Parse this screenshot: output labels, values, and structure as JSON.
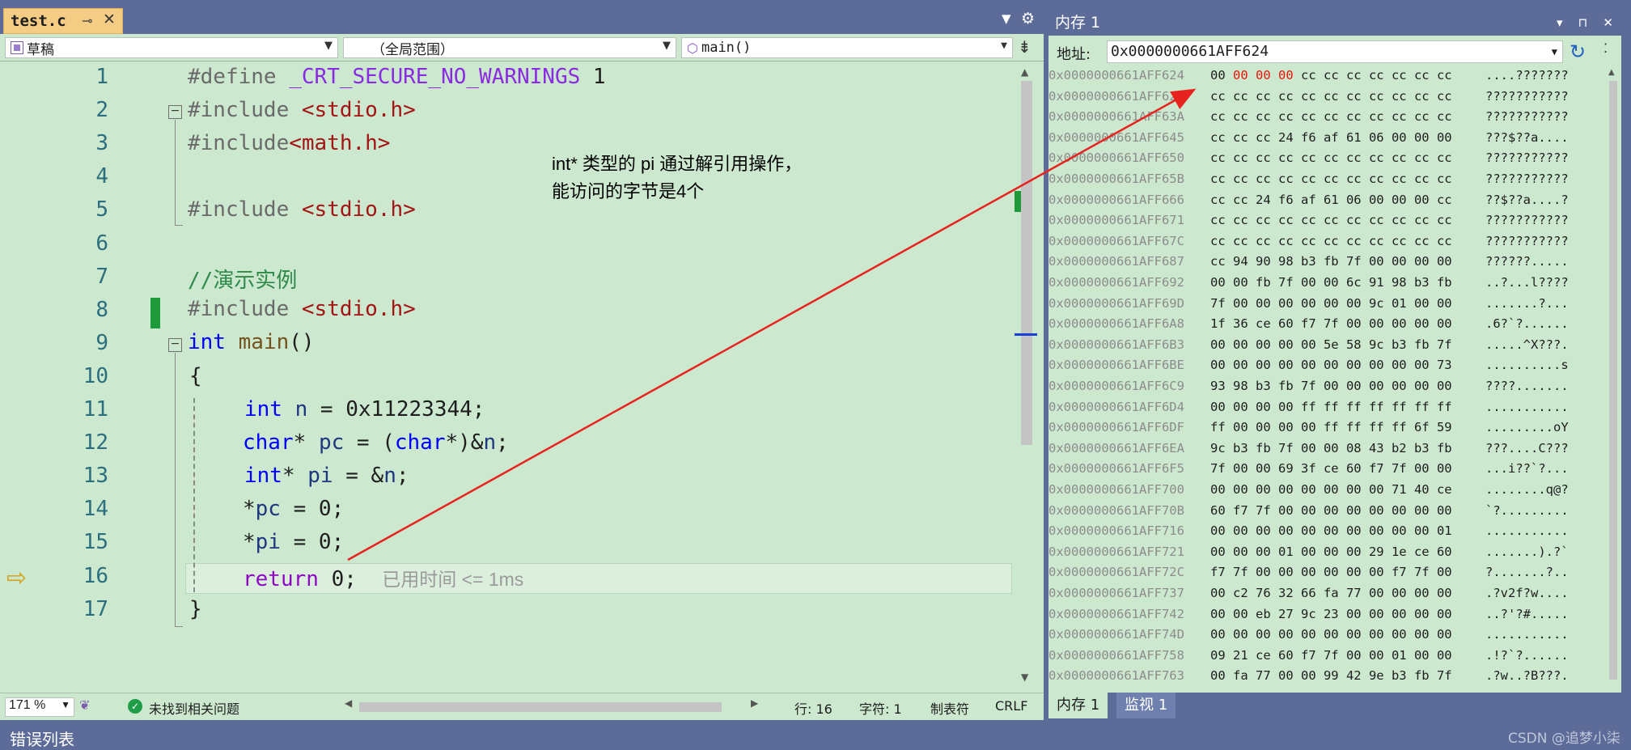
{
  "editor": {
    "tab": {
      "title": "test.c",
      "pin": "⊸",
      "close": "✕"
    },
    "nav": {
      "project": "草稿",
      "scope": "（全局范围）",
      "function": "main()"
    },
    "lines": [
      "1",
      "2",
      "3",
      "4",
      "5",
      "6",
      "7",
      "8",
      "9",
      "10",
      "11",
      "12",
      "13",
      "14",
      "15",
      "16",
      "17"
    ],
    "code": {
      "l1_kw": "#define ",
      "l1_macro": "_CRT_SECURE_NO_WARNINGS",
      "l1_val": " 1",
      "l2_kw": "#include ",
      "l2_hdr": "<stdio.h>",
      "l3_kw": "#include",
      "l3_hdr": "<math.h>",
      "l5_kw": "#include ",
      "l5_hdr": "<stdio.h>",
      "l7_comment": "//演示实例",
      "l8_kw": "#include ",
      "l8_hdr": "<stdio.h>",
      "l9_type": "int",
      "l9_name": " main",
      "l9_rest": "()",
      "l10": "{",
      "l11_type": "int",
      "l11_var": " n",
      "l11_rest": " = 0x11223344;",
      "l12_type": "char",
      "l12_ptr": "* ",
      "l12_var": "pc",
      "l12_eq": " = (",
      "l12_cast": "char",
      "l12_cast2": "*)&",
      "l12_n": "n",
      "l12_end": ";",
      "l13_type": "int",
      "l13_ptr": "* ",
      "l13_var": "pi",
      "l13_eq": " = &",
      "l13_n": "n",
      "l13_end": ";",
      "l14_star": "*",
      "l14_var": "pc",
      "l14_rest": " = 0;",
      "l15_star": "*",
      "l15_var": "pi",
      "l15_rest": " = 0;",
      "l16_ret": "return",
      "l16_rest": " 0;",
      "l16_elapsed": "已用时间 <= 1ms",
      "l17": "}"
    },
    "annotation": {
      "line1": "int* 类型的 pi 通过解引用操作，",
      "line2": "能访问的字节是4个"
    },
    "status": {
      "zoom": "171 %",
      "message": "未找到相关问题",
      "line": "行: 16",
      "char": "字符: 1",
      "tabs": "制表符",
      "eol": "CRLF"
    }
  },
  "memory": {
    "title": "内存 1",
    "address_label": "地址:",
    "address_value": "0x0000000661AFF624",
    "tabs": [
      "内存 1",
      "监视 1"
    ],
    "rows": [
      {
        "addr": "0x0000000661AFF624",
        "changed": "00 00 00",
        "pre": "00 ",
        "bytes": " cc cc cc cc cc cc cc",
        "ascii": "....???????"
      },
      {
        "addr": "0x0000000661AFF62F",
        "pre": "",
        "changed": "",
        "bytes": "cc cc cc cc cc cc cc cc cc cc cc",
        "ascii": "???????????"
      },
      {
        "addr": "0x0000000661AFF63A",
        "pre": "",
        "changed": "",
        "bytes": "cc cc cc cc cc cc cc cc cc cc cc",
        "ascii": "???????????"
      },
      {
        "addr": "0x0000000661AFF645",
        "pre": "",
        "changed": "",
        "bytes": "cc cc cc 24 f6 af 61 06 00 00 00",
        "ascii": "???$??a...."
      },
      {
        "addr": "0x0000000661AFF650",
        "pre": "",
        "changed": "",
        "bytes": "cc cc cc cc cc cc cc cc cc cc cc",
        "ascii": "???????????"
      },
      {
        "addr": "0x0000000661AFF65B",
        "pre": "",
        "changed": "",
        "bytes": "cc cc cc cc cc cc cc cc cc cc cc",
        "ascii": "???????????"
      },
      {
        "addr": "0x0000000661AFF666",
        "pre": "",
        "changed": "",
        "bytes": "cc cc 24 f6 af 61 06 00 00 00 cc",
        "ascii": "??$??a....?"
      },
      {
        "addr": "0x0000000661AFF671",
        "pre": "",
        "changed": "",
        "bytes": "cc cc cc cc cc cc cc cc cc cc cc",
        "ascii": "???????????"
      },
      {
        "addr": "0x0000000661AFF67C",
        "pre": "",
        "changed": "",
        "bytes": "cc cc cc cc cc cc cc cc cc cc cc",
        "ascii": "???????????"
      },
      {
        "addr": "0x0000000661AFF687",
        "pre": "",
        "changed": "",
        "bytes": "cc 94 90 98 b3 fb 7f 00 00 00 00",
        "ascii": "??????....."
      },
      {
        "addr": "0x0000000661AFF692",
        "pre": "",
        "changed": "",
        "bytes": "00 00 fb 7f 00 00 6c 91 98 b3 fb",
        "ascii": "..?...l????"
      },
      {
        "addr": "0x0000000661AFF69D",
        "pre": "",
        "changed": "",
        "bytes": "7f 00 00 00 00 00 00 9c 01 00 00",
        "ascii": ".......?..."
      },
      {
        "addr": "0x0000000661AFF6A8",
        "pre": "",
        "changed": "",
        "bytes": "1f 36 ce 60 f7 7f 00 00 00 00 00",
        "ascii": ".6?`?......"
      },
      {
        "addr": "0x0000000661AFF6B3",
        "pre": "",
        "changed": "",
        "bytes": "00 00 00 00 00 5e 58 9c b3 fb 7f",
        "ascii": ".....^X???."
      },
      {
        "addr": "0x0000000661AFF6BE",
        "pre": "",
        "changed": "",
        "bytes": "00 00 00 00 00 00 00 00 00 00 73",
        "ascii": "..........s"
      },
      {
        "addr": "0x0000000661AFF6C9",
        "pre": "",
        "changed": "",
        "bytes": "93 98 b3 fb 7f 00 00 00 00 00 00",
        "ascii": "????......."
      },
      {
        "addr": "0x0000000661AFF6D4",
        "pre": "",
        "changed": "",
        "bytes": "00 00 00 00 ff ff ff ff ff ff ff",
        "ascii": "..........."
      },
      {
        "addr": "0x0000000661AFF6DF",
        "pre": "",
        "changed": "",
        "bytes": "ff 00 00 00 00 ff ff ff ff 6f 59",
        "ascii": ".........oY"
      },
      {
        "addr": "0x0000000661AFF6EA",
        "pre": "",
        "changed": "",
        "bytes": "9c b3 fb 7f 00 00 08 43 b2 b3 fb",
        "ascii": "???....C???"
      },
      {
        "addr": "0x0000000661AFF6F5",
        "pre": "",
        "changed": "",
        "bytes": "7f 00 00 69 3f ce 60 f7 7f 00 00",
        "ascii": "...i??`?..."
      },
      {
        "addr": "0x0000000661AFF700",
        "pre": "",
        "changed": "",
        "bytes": "00 00 00 00 00 00 00 00 71 40 ce",
        "ascii": "........q@?"
      },
      {
        "addr": "0x0000000661AFF70B",
        "pre": "",
        "changed": "",
        "bytes": "60 f7 7f 00 00 00 00 00 00 00 00",
        "ascii": "`?........."
      },
      {
        "addr": "0x0000000661AFF716",
        "pre": "",
        "changed": "",
        "bytes": "00 00 00 00 00 00 00 00 00 00 01",
        "ascii": "..........."
      },
      {
        "addr": "0x0000000661AFF721",
        "pre": "",
        "changed": "",
        "bytes": "00 00 00 01 00 00 00 29 1e ce 60",
        "ascii": ".......).?`"
      },
      {
        "addr": "0x0000000661AFF72C",
        "pre": "",
        "changed": "",
        "bytes": "f7 7f 00 00 00 00 00 00 f7 7f 00",
        "ascii": "?.......?.."
      },
      {
        "addr": "0x0000000661AFF737",
        "pre": "",
        "changed": "",
        "bytes": "00 c2 76 32 66 fa 77 00 00 00 00",
        "ascii": ".?v2f?w...."
      },
      {
        "addr": "0x0000000661AFF742",
        "pre": "",
        "changed": "",
        "bytes": "00 00 eb 27 9c 23 00 00 00 00 00",
        "ascii": "..?'?#....."
      },
      {
        "addr": "0x0000000661AFF74D",
        "pre": "",
        "changed": "",
        "bytes": "00 00 00 00 00 00 00 00 00 00 00",
        "ascii": "..........."
      },
      {
        "addr": "0x0000000661AFF758",
        "pre": "",
        "changed": "",
        "bytes": "09 21 ce 60 f7 7f 00 00 01 00 00",
        "ascii": ".!?`?......"
      },
      {
        "addr": "0x0000000661AFF763",
        "pre": "",
        "changed": "",
        "bytes": "00 fa 77 00 00 99 42 9e b3 fb 7f",
        "ascii": ".?w..?B???."
      }
    ]
  },
  "bottom": {
    "error_list": "错误列表",
    "watermark": "CSDN @追梦小柒"
  },
  "colors": {
    "editor_bg": "#cce8cf",
    "chrome": "#5d6b99",
    "tab_active": "#f5cc84",
    "keyword": "#0000ff",
    "changed_byte": "#e8160c",
    "arrow": "#e8231f"
  }
}
